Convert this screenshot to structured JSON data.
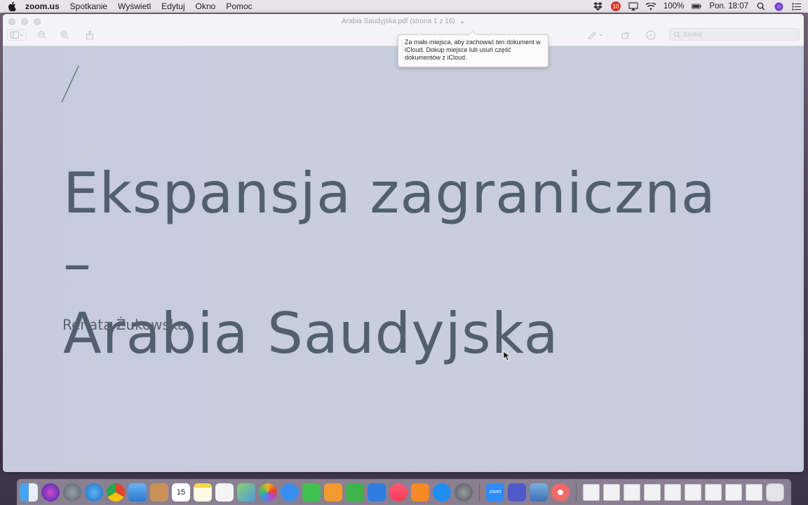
{
  "menubar": {
    "app_name": "zoom.us",
    "items": [
      "Spotkanie",
      "Wyświetl",
      "Edytuj",
      "Okno",
      "Pomoc"
    ],
    "battery": "100%",
    "clock": "Pon. 18:07",
    "badge_count": "10"
  },
  "window": {
    "title": "Arabia Saudyjska.pdf (strona 1 z 16)",
    "search_placeholder": "Szukaj"
  },
  "tooltip": {
    "text": "Za mało miejsca, aby zachować ten dokument w iCloud. Dokup miejsce lub usuń część dokumentów z iCloud."
  },
  "slide": {
    "title_line1": "Ekspansja zagraniczna –",
    "title_line2": "Arabia Saudyjska",
    "author": "Renata Żukowska"
  },
  "dock": {
    "calendar_day": "15",
    "zoom_label": "zoom",
    "icons": [
      "finder-icon",
      "siri-icon",
      "launchpad-icon",
      "safari-icon",
      "chrome-icon",
      "mail-icon",
      "contacts-icon",
      "calendar-icon",
      "notes-icon",
      "reminders-icon",
      "maps-icon",
      "photos-icon",
      "messages-icon",
      "facetime-icon",
      "pages-icon",
      "numbers-icon",
      "keynote-icon",
      "music-icon",
      "books-icon",
      "appstore-icon",
      "settings-icon",
      "zoom-icon",
      "teams-icon",
      "preview-icon",
      "asana-icon"
    ]
  }
}
